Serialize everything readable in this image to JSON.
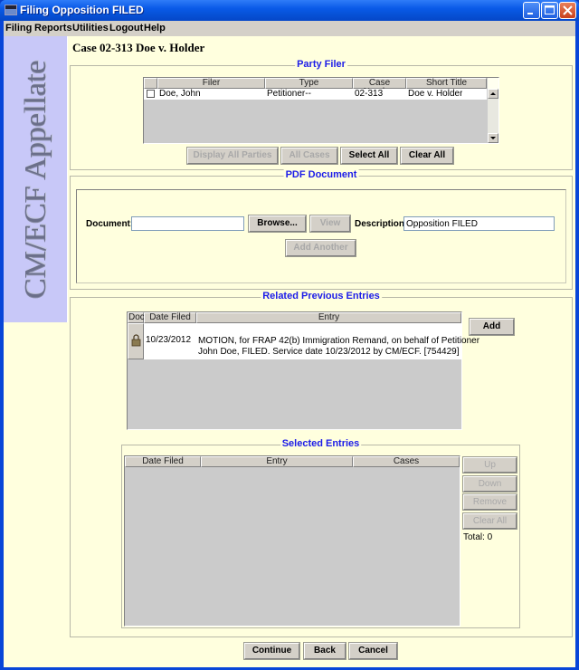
{
  "window": {
    "title": "Filing Opposition FILED",
    "controls": [
      "minimize",
      "maximize",
      "close"
    ]
  },
  "menu": [
    "Filing",
    "Reports",
    "Utilities",
    "Logout",
    "Help"
  ],
  "sidebar": {
    "brand": "CM/ECF Appellate"
  },
  "case_title": "Case 02-313 Doe v. Holder",
  "party_filer": {
    "title": "Party Filer",
    "columns": [
      "",
      "Filer",
      "Type",
      "Case Number",
      "Short Title"
    ],
    "rows": [
      {
        "checked": false,
        "filer": "Doe, John",
        "type": "Petitioner--",
        "case_number": "02-313",
        "short_title": "Doe v. Holder"
      }
    ],
    "buttons": {
      "display_all_parties": "Display All Parties",
      "all_cases": "All Cases",
      "select_all": "Select All",
      "clear_all": "Clear All"
    }
  },
  "pdf_document": {
    "title": "PDF Document",
    "document_label": "Document:",
    "document_value": "",
    "browse": "Browse...",
    "view": "View",
    "description_label": "Description:",
    "description_value": "Opposition FILED",
    "add_another": "Add Another"
  },
  "related_entries": {
    "title": "Related Previous Entries",
    "columns": [
      "Doc",
      "Date Filed",
      "Entry"
    ],
    "rows": [
      {
        "doc_icon": "document-lock-icon",
        "date_filed": "10/23/2012",
        "entry_line1": "MOTION, for FRAP 42(b) Immigration Remand, on behalf of Petitioner",
        "entry_line2": "John Doe, FILED. Service date 10/23/2012 by CM/ECF. [754429]"
      }
    ],
    "add": "Add"
  },
  "selected_entries": {
    "title": "Selected Entries",
    "columns": [
      "Date Filed",
      "Entry",
      "Cases"
    ],
    "rows": [],
    "buttons": {
      "up": "Up",
      "down": "Down",
      "remove": "Remove",
      "clear_all": "Clear All"
    },
    "total": "Total: 0"
  },
  "footer": {
    "continue": "Continue",
    "back": "Back",
    "cancel": "Cancel"
  }
}
